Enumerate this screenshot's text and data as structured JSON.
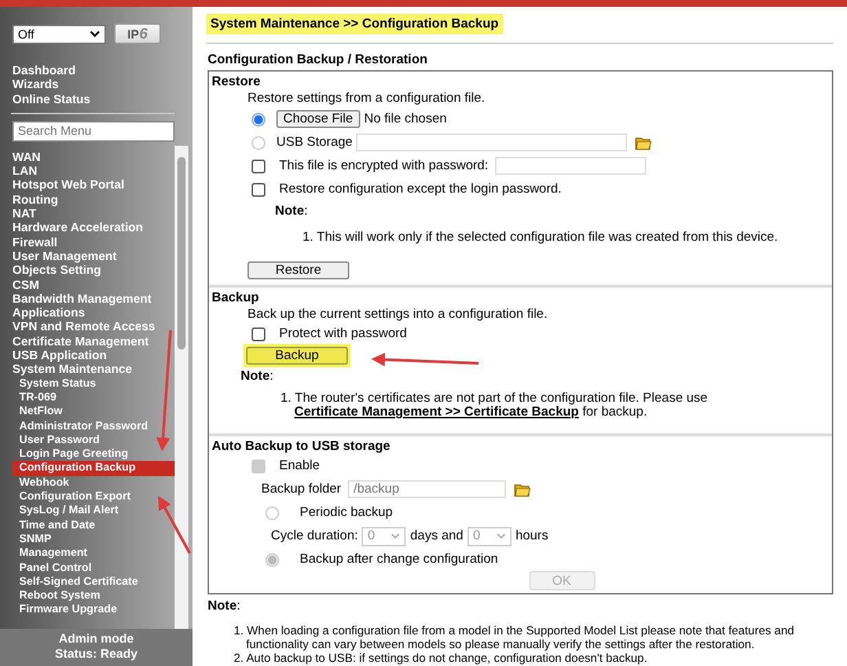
{
  "sidebar": {
    "mode_select": {
      "value": "Off"
    },
    "ipv6_button": {
      "label": "IP",
      "suffix": "6"
    },
    "quick_links": [
      {
        "label": "Dashboard"
      },
      {
        "label": "Wizards"
      },
      {
        "label": "Online Status"
      }
    ],
    "search": {
      "placeholder": "Search Menu"
    },
    "menu": [
      {
        "label": "WAN",
        "selected": false
      },
      {
        "label": "LAN",
        "selected": false
      },
      {
        "label": "Hotspot Web Portal",
        "selected": false
      },
      {
        "label": "Routing",
        "selected": false
      },
      {
        "label": "NAT",
        "selected": false
      },
      {
        "label": "Hardware Acceleration",
        "selected": false
      },
      {
        "label": "Firewall",
        "selected": false
      },
      {
        "label": "User Management",
        "selected": false
      },
      {
        "label": "Objects Setting",
        "selected": false
      },
      {
        "label": "CSM",
        "selected": false
      },
      {
        "label": "Bandwidth Management",
        "selected": false
      },
      {
        "label": "Applications",
        "selected": false
      },
      {
        "label": "VPN and Remote Access",
        "selected": false
      },
      {
        "label": "Certificate Management",
        "selected": false
      },
      {
        "label": "USB Application",
        "selected": false
      },
      {
        "label": "System Maintenance",
        "selected": false,
        "children": [
          {
            "label": "System Status",
            "selected": false
          },
          {
            "label": "TR-069",
            "selected": false
          },
          {
            "label": "NetFlow",
            "selected": false
          },
          {
            "label": "Administrator Password",
            "selected": false
          },
          {
            "label": "User Password",
            "selected": false
          },
          {
            "label": "Login Page Greeting",
            "selected": false
          },
          {
            "label": "Configuration Backup",
            "selected": true
          },
          {
            "label": "Webhook",
            "selected": false
          },
          {
            "label": "Configuration Export",
            "selected": false
          },
          {
            "label": "SysLog / Mail Alert",
            "selected": false
          },
          {
            "label": "Time and Date",
            "selected": false
          },
          {
            "label": "SNMP",
            "selected": false
          },
          {
            "label": "Management",
            "selected": false
          },
          {
            "label": "Panel Control",
            "selected": false
          },
          {
            "label": "Self-Signed Certificate",
            "selected": false
          },
          {
            "label": "Reboot System",
            "selected": false
          },
          {
            "label": "Firmware Upgrade",
            "selected": false
          }
        ]
      }
    ],
    "status": [
      "Admin mode",
      "Status: Ready"
    ]
  },
  "breadcrumb": {
    "text": "System Maintenance >> Configuration Backup",
    "highlighted": true
  },
  "title": "Configuration Backup / Restoration",
  "restore": {
    "title": "Restore",
    "description": "Restore settings from a configuration file.",
    "sources": [
      {
        "kind": "file",
        "selected": true,
        "button": "Choose File",
        "status": "No file chosen"
      },
      {
        "kind": "usb",
        "selected": false,
        "label": "USB Storage"
      }
    ],
    "options": [
      {
        "kind": "password",
        "label": "This file is encrypted with password:",
        "checked": false
      },
      {
        "kind": "plain",
        "label": "Restore configuration except the login password.",
        "checked": false
      }
    ],
    "note_label": "**Note**:",
    "notes": [
      {
        "text": "1. This will work only if the selected configuration file was created from this device."
      }
    ],
    "button": "Restore"
  },
  "backup": {
    "title": "Backup",
    "description": "Back up the current settings into a configuration file.",
    "protect": {
      "label": "Protect with password",
      "checked": false
    },
    "button": {
      "label": "Backup",
      "highlighted": true
    },
    "note_label": "**Note**:",
    "notes": [
      {
        "text": "1. The router's certificates are not part of the configuration file. Please use",
        "link": "Certificate Management >> Certificate Backup",
        "after": "for backup."
      }
    ]
  },
  "auto_backup": {
    "title": "Auto Backup to USB storage",
    "enable": {
      "label": "Enable",
      "checked": true,
      "disabled": true
    },
    "folder": {
      "label": "Backup folder",
      "value": "/backup"
    },
    "modes": [
      {
        "kind": "periodic",
        "label": "Periodic backup",
        "selected": false
      },
      {
        "kind": "change",
        "label": "Backup after change configuration",
        "selected": true
      }
    ],
    "cycle": {
      "label": "Cycle duration:",
      "days": "0",
      "days_label": "days and",
      "hours": "0",
      "hours_label": "hours"
    },
    "button": {
      "label": "OK",
      "disabled": true
    }
  },
  "footer_note": {
    "label": "**Note**:",
    "items": [
      "1. When loading a configuration file from a model in the Supported Model List please note that features and functionality can vary between models so please manually verify the settings after the restoration.",
      "2. Auto backup to USB: if settings do not change, configuration doesn't backup."
    ]
  }
}
